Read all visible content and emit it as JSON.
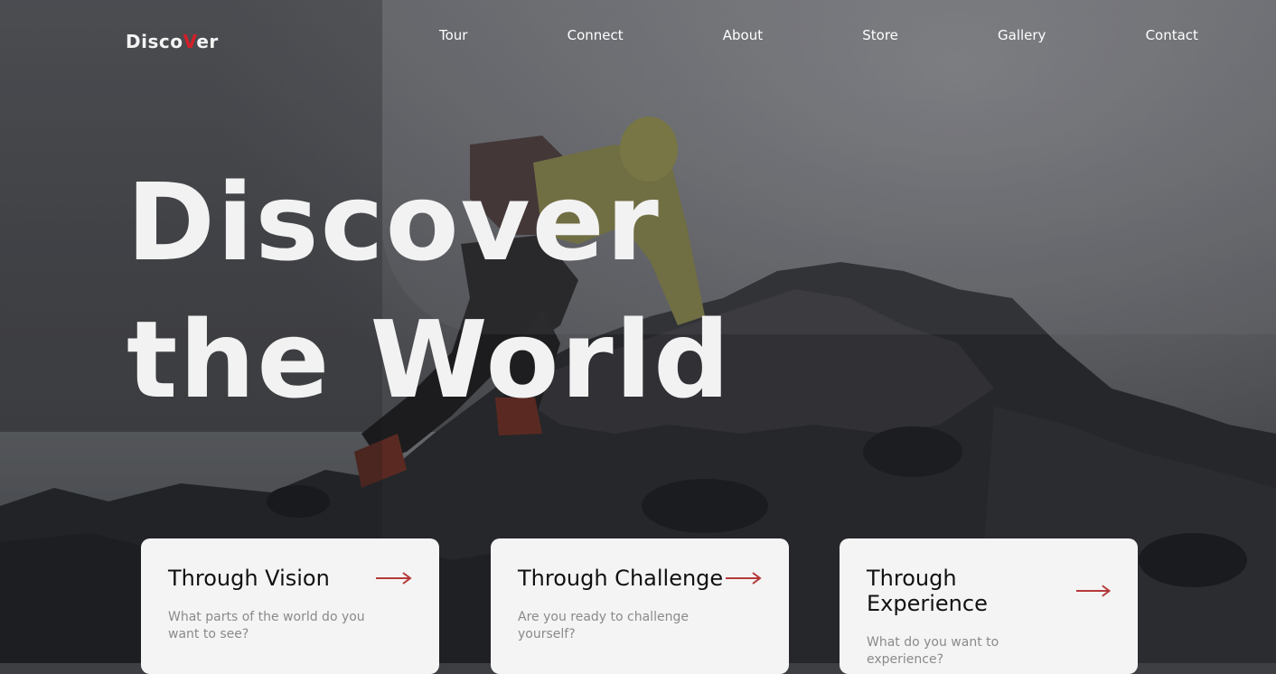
{
  "brand": {
    "text_before": "Disco",
    "text_accent": "V",
    "text_after": "er",
    "accent_color": "#d41f28"
  },
  "nav": {
    "items": [
      {
        "label": "Tour"
      },
      {
        "label": "Connect"
      },
      {
        "label": "About"
      },
      {
        "label": "Store"
      },
      {
        "label": "Gallery"
      },
      {
        "label": "Contact"
      }
    ]
  },
  "hero": {
    "line1": "Discover",
    "line2": "the World",
    "image": "person climbing dark volcanic rocks by the sea"
  },
  "cards": [
    {
      "title": "Through Vision",
      "desc": "What parts of the world do you want to see?",
      "icon": "arrow-right-icon"
    },
    {
      "title": "Through Challenge",
      "desc": "Are you ready to challenge yourself?",
      "icon": "arrow-right-icon"
    },
    {
      "title": "Through Experience",
      "desc": "What do you want to experience?",
      "icon": "arrow-right-icon"
    }
  ],
  "colors": {
    "accent": "#b5393a",
    "card_bg": "#f4f4f4",
    "text_white": "#ffffff"
  }
}
